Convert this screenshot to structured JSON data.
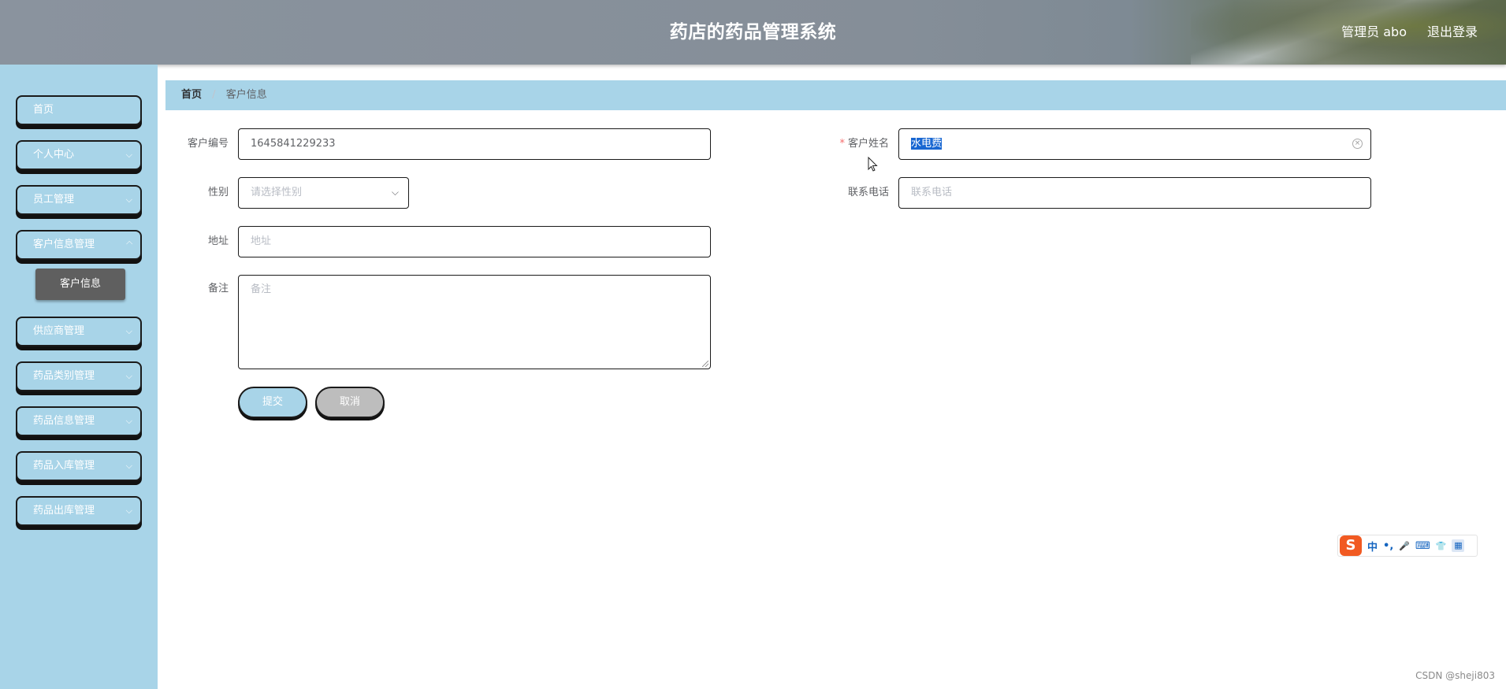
{
  "header": {
    "title": "药店的药品管理系统",
    "user_label": "管理员 abo",
    "logout_label": "退出登录"
  },
  "sidebar": {
    "items": [
      {
        "label": "首页"
      },
      {
        "label": "个人中心"
      },
      {
        "label": "员工管理"
      },
      {
        "label": "客户信息管理"
      },
      {
        "label": "供应商管理"
      },
      {
        "label": "药品类别管理"
      },
      {
        "label": "药品信息管理"
      },
      {
        "label": "药品入库管理"
      },
      {
        "label": "药品出库管理"
      }
    ],
    "submenu_active": "客户信息",
    "chevron": "⌵"
  },
  "breadcrumb": {
    "home": "首页",
    "separator": "/",
    "current": "客户信息"
  },
  "form": {
    "customer_id": {
      "label": "客户编号",
      "value": "1645841229233"
    },
    "customer_name": {
      "label": "客户姓名",
      "required_mark": "*",
      "value": "水电费"
    },
    "gender": {
      "label": "性别",
      "placeholder": "请选择性别"
    },
    "phone": {
      "label": "联系电话",
      "placeholder": "联系电话"
    },
    "address": {
      "label": "地址",
      "placeholder": "地址"
    },
    "remark": {
      "label": "备注",
      "placeholder": "备注"
    },
    "submit_label": "提交",
    "cancel_label": "取消"
  },
  "ime_toolbar": {
    "logo": "S",
    "items": [
      "中",
      "•,",
      "🎤",
      "⌨",
      "👕",
      "▦"
    ]
  },
  "watermark": "CSDN @sheji803",
  "colors": {
    "sidebar_bg": "#a8d4e8",
    "active_submenu": "#5f5f5f",
    "selection": "#1967d2",
    "required": "#f56c6c"
  }
}
